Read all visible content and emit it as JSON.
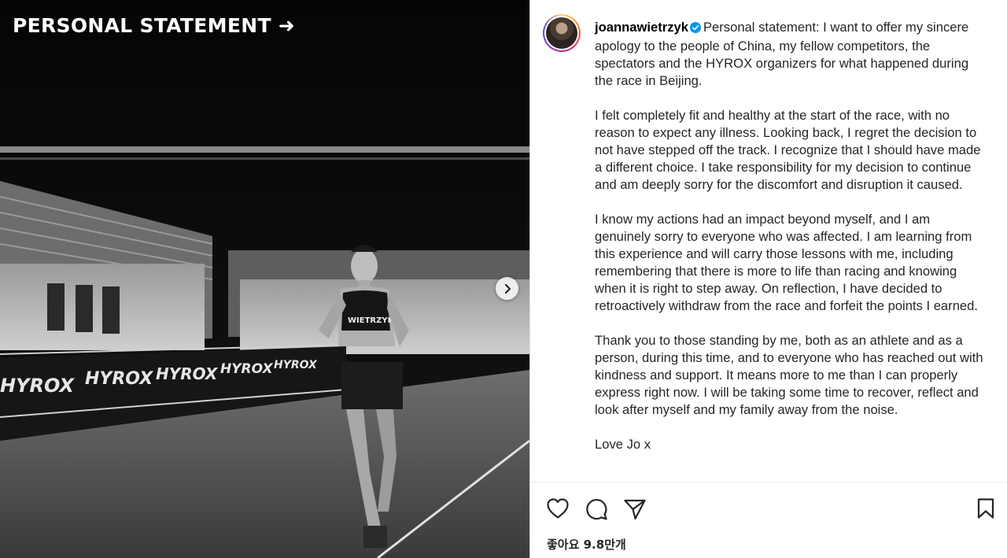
{
  "media": {
    "overlay_title": "PERSONAL STATEMENT ➜",
    "banner_text": "HYROX",
    "bib_text": "WIETRZYK"
  },
  "post": {
    "username": "joannawietrzyk",
    "caption": "Personal statement: I want to offer my sincere apology to the people of China, my fellow competitors, the spectators and the HYROX organizers for what happened during the race in Beijing.\n\nI felt completely fit and healthy at the start of the race, with no reason to expect any illness. Looking back, I regret the decision to not have stepped off the track. I recognize that I should have made a different choice. I take responsibility for my decision to continue and am deeply sorry for the discomfort and disruption it caused.\n\nI know my actions had an impact beyond myself, and I am genuinely sorry to everyone who was affected. I am learning from this experience and will carry those lessons with me, including remembering that there is more to life than racing and knowing when it is right to step away. On reflection, I have decided to retroactively withdraw from the race and forfeit the points I earned.\n\nThank you to those standing by me, both as an athlete and as a person, during this time, and to everyone who has reached out with kindness and support. It means more to me than I can properly express right now. I will be taking some time to recover, reflect and look after myself and my family away from the noise.\n\nLove Jo x",
    "likes": "좋아요 9.8만개"
  },
  "icons": {
    "next": "chevron-right-icon",
    "like": "heart-icon",
    "comment": "comment-icon",
    "share": "send-icon",
    "save": "bookmark-icon",
    "verified": "verified-badge-icon"
  },
  "colors": {
    "verified": "#0095f6",
    "text": "#262626"
  }
}
